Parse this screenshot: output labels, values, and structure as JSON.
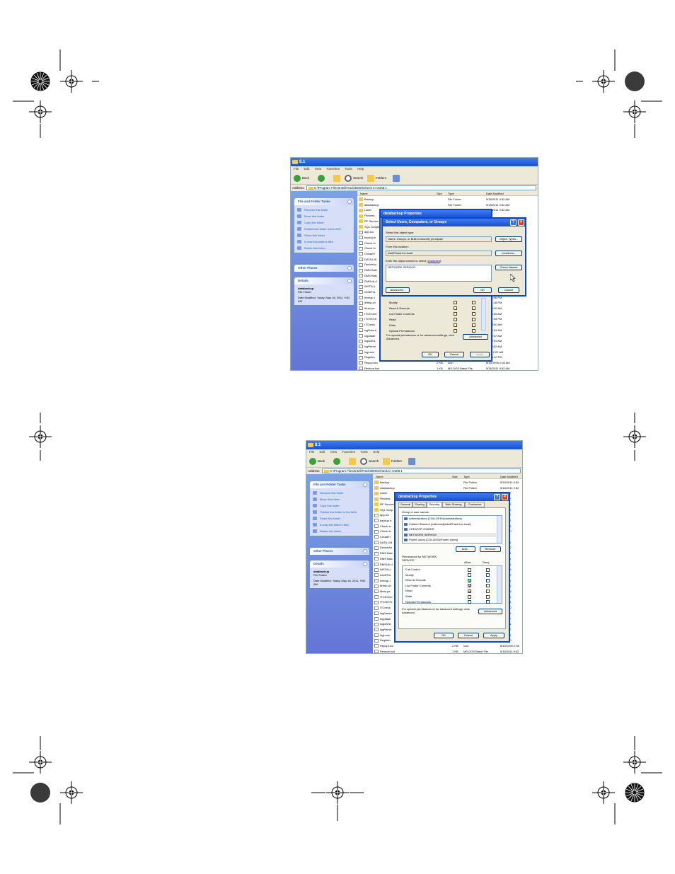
{
  "screenshot1": {
    "window_title": "8.1",
    "menu": [
      "File",
      "Edit",
      "View",
      "Favorites",
      "Tools",
      "Help"
    ],
    "toolbar": {
      "back": "Back",
      "search": "Search",
      "folders": "Folders"
    },
    "address_label": "Address",
    "address_value": "C:\\Program Files\\IntelliTrack\\DMS\\Check In Out\\8.1",
    "columns": {
      "name": "Name",
      "size": "Size",
      "type": "Type",
      "date": "Date Modified"
    },
    "files": [
      {
        "name": "Backup",
        "size": "",
        "type": "File Folder",
        "date": "5/18/2011 9:52 AM"
      },
      {
        "name": "databackup",
        "size": "",
        "type": "File Folder",
        "date": "5/18/2011 9:52 AM"
      },
      {
        "name": "Label",
        "size": "",
        "type": "",
        "date": "5/18/2011 9:52 AM"
      },
      {
        "name": "Pictures",
        "size": "",
        "type": "",
        "date": ""
      },
      {
        "name": "RF Service",
        "size": "",
        "type": "",
        "date": ""
      },
      {
        "name": "SQL Scripts",
        "size": "",
        "type": "",
        "date": ""
      },
      {
        "name": "app.ico",
        "size": "",
        "type": "",
        "date": ""
      },
      {
        "name": "backup.b",
        "size": "",
        "type": "",
        "date": ""
      },
      {
        "name": "Check In",
        "size": "",
        "type": "",
        "date": ""
      },
      {
        "name": "Check In",
        "size": "",
        "type": "",
        "date": ""
      },
      {
        "name": "CreateIT",
        "size": "",
        "type": "",
        "date": ""
      },
      {
        "name": "DATA.LIB",
        "size": "",
        "type": "",
        "date": ""
      },
      {
        "name": "DeviceAo",
        "size": "",
        "type": "",
        "date": ""
      },
      {
        "name": "DMS Batc",
        "size": "",
        "type": "",
        "date": ""
      },
      {
        "name": "DMS Batc",
        "size": "",
        "type": "",
        "date": ""
      },
      {
        "name": "DMSLib.d",
        "size": "",
        "type": "",
        "date": ""
      },
      {
        "name": "INSTALL",
        "size": "",
        "type": "",
        "date": ""
      },
      {
        "name": "IntelliTra",
        "size": "",
        "type": "",
        "date": "011 4:06 PM"
      },
      {
        "name": "Interop.I",
        "size": "",
        "type": "",
        "date": "011 4:06 PM"
      },
      {
        "name": "ItHelp.ch",
        "size": "",
        "type": "",
        "date": "011 1:16 PM"
      },
      {
        "name": "ItInfo.pa",
        "size": "",
        "type": "",
        "date": "999 3:05 AM"
      },
      {
        "name": "ITCECher",
        "size": "",
        "type": "",
        "date": "011 8:50 AM"
      },
      {
        "name": "ITCHECK",
        "size": "",
        "type": "",
        "date": "011 1:54 PM"
      },
      {
        "name": "ITCheck.",
        "size": "",
        "type": "",
        "date": "010 8:50 AM"
      },
      {
        "name": "logData.e",
        "size": "",
        "type": "",
        "date": "011 9:51 AM"
      },
      {
        "name": "logdatab",
        "size": "",
        "type": "",
        "date": "011 9:47 AM"
      },
      {
        "name": "logDATA",
        "size": "",
        "type": "",
        "date": "011 9:51 AM"
      },
      {
        "name": "logPermi",
        "size": "",
        "type": "",
        "date": "011 9:52 AM"
      },
      {
        "name": "logLexe",
        "size": "",
        "type": "",
        "date": "011 12:22 AM"
      },
      {
        "name": "Register",
        "size": "",
        "type": "",
        "date": "008 5:10 PM"
      },
      {
        "name": "Repcpt.ico",
        "size": "2 KB",
        "type": "Icon",
        "date": "8/15/1995 2:08 AM"
      },
      {
        "name": "Restore.bat",
        "size": "1 KB",
        "type": "MS-DOS Batch File",
        "date": "5/18/2011 9:52 AM"
      }
    ],
    "side": {
      "tasks_title": "File and Folder Tasks",
      "tasks": [
        "Rename this folder",
        "Move this folder",
        "Copy this folder",
        "Publish this folder to the Web",
        "Share this folder",
        "E-mail this folder's files",
        "Delete this folder"
      ],
      "other_places": "Other Places",
      "details": "Details",
      "detail_name": "databackup",
      "detail_type": "File Folder",
      "detail_date": "Date Modified: Today, May 18, 2011, 9:52 AM"
    },
    "props": {
      "title": "databackup Properties",
      "perms": [
        "Modify",
        "Read & Execute",
        "List Folder Contents",
        "Read",
        "Write",
        "Special Permissions"
      ],
      "special_note": "For special permissions or for advanced settings, click Advanced.",
      "advanced": "Advanced",
      "ok": "OK",
      "cancel": "Cancel",
      "apply": "Apply"
    },
    "select": {
      "title": "Select Users, Computers, or Groups",
      "obj_type_label": "Select this object type:",
      "obj_type_value": "Users, Groups, or Built-in security principals",
      "obj_types_btn": "Object Types...",
      "loc_label": "From this location:",
      "loc_value": "IntelliTrack.Inc.local",
      "loc_btn": "Locations...",
      "names_label_pre": "Enter the object names to select (",
      "names_label_link": "examples",
      "names_label_post": "):",
      "names_value": "NETWORK SERVICE",
      "check_btn": "Check Names",
      "advanced_btn": "Advanced...",
      "ok": "OK",
      "cancel": "Cancel"
    }
  },
  "screenshot2": {
    "window_title": "8.1",
    "menu": [
      "File",
      "Edit",
      "View",
      "Favorites",
      "Tools",
      "Help"
    ],
    "toolbar": {
      "back": "Back",
      "search": "Search",
      "folders": "Folders"
    },
    "address_label": "Address",
    "address_value": "C:\\Program Files\\IntelliTrack\\DMS\\Check In Out\\8.1",
    "columns": {
      "name": "Name",
      "size": "Size",
      "type": "Type",
      "date": "Date Modified"
    },
    "files": [
      {
        "name": "Backup",
        "size": "",
        "type": "File Folder",
        "date": "5/18/2011 9:52"
      },
      {
        "name": "databackup",
        "size": "",
        "type": "File Folder",
        "date": "5/18/2011 9:52"
      },
      {
        "name": "Label",
        "size": "",
        "type": "",
        "date": "011 9:52"
      },
      {
        "name": "Pictures",
        "size": "",
        "type": "",
        "date": "011 9:52"
      },
      {
        "name": "RF Service",
        "size": "",
        "type": "",
        "date": "011 9:52"
      },
      {
        "name": "SQL Scrip",
        "size": "",
        "type": "",
        "date": "011 9:52"
      },
      {
        "name": "app.ico",
        "size": "",
        "type": "",
        "date": "011 9:47"
      },
      {
        "name": "backup.b",
        "size": "",
        "type": "",
        "date": "011 9:52"
      },
      {
        "name": "Check In",
        "size": "",
        "type": "",
        "date": "003 1:41"
      },
      {
        "name": "Check In",
        "size": "",
        "type": "",
        "date": "010 8:50"
      },
      {
        "name": "CreateIT",
        "size": "",
        "type": "",
        "date": "008 3:1"
      },
      {
        "name": "DATA.LIB",
        "size": "",
        "type": "",
        "date": "011 1:15"
      },
      {
        "name": "DeviceAo",
        "size": "",
        "type": "",
        "date": "010 10:2"
      },
      {
        "name": "DMS Batc",
        "size": "",
        "type": "",
        "date": "011 4:06"
      },
      {
        "name": "DMS Batc",
        "size": "",
        "type": "",
        "date": "011 4:06"
      },
      {
        "name": "DMSLib.d",
        "size": "",
        "type": "",
        "date": "011 4:06"
      },
      {
        "name": "INSTALL",
        "size": "",
        "type": "",
        "date": "010 9:24"
      },
      {
        "name": "IntelliTra",
        "size": "",
        "type": "",
        "date": "010 3:57"
      },
      {
        "name": "Interop.I",
        "size": "",
        "type": "",
        "date": "011 4:06"
      },
      {
        "name": "ItHelp.ch",
        "size": "",
        "type": "",
        "date": "011 1:16"
      },
      {
        "name": "ItInfo.pa",
        "size": "",
        "type": "",
        "date": "999 3:05"
      },
      {
        "name": "ITCECher",
        "size": "",
        "type": "",
        "date": "011 8:50"
      },
      {
        "name": "ITCHECK",
        "size": "",
        "type": "",
        "date": "011 1:54"
      },
      {
        "name": "ITCheck.",
        "size": "",
        "type": "",
        "date": "010 8:50"
      },
      {
        "name": "logData.e",
        "size": "",
        "type": "",
        "date": "011 9:51"
      },
      {
        "name": "logdatab",
        "size": "",
        "type": "",
        "date": "011 9:47"
      },
      {
        "name": "logDATA",
        "size": "",
        "type": "",
        "date": "011 9:51"
      },
      {
        "name": "logPermi",
        "size": "",
        "type": "",
        "date": "011 9:52"
      },
      {
        "name": "logLexe",
        "size": "",
        "type": "",
        "date": "011 12:2"
      },
      {
        "name": "Register",
        "size": "",
        "type": "",
        "date": "008 5:10"
      },
      {
        "name": "Repcpt.ico",
        "size": "2 KB",
        "type": "Icon",
        "date": "8/15/1995 2:08"
      },
      {
        "name": "Restore.bat",
        "size": "1 KB",
        "type": "MS-DOS Batch File",
        "date": "5/18/2011 9:52"
      }
    ],
    "side": {
      "tasks_title": "File and Folder Tasks",
      "tasks": [
        "Rename this folder",
        "Move this folder",
        "Copy this folder",
        "Publish this folder to the Web",
        "Share this folder",
        "E-mail this folder's files",
        "Delete this folder"
      ],
      "other_places": "Other Places",
      "details": "Details",
      "detail_name": "databackup",
      "detail_type": "File Folder",
      "detail_date": "Date Modified: Today, May 18, 2011, 9:52 AM"
    },
    "props": {
      "title": "databackup Properties",
      "tabs": [
        "General",
        "Sharing",
        "Security",
        "Web Sharing",
        "Customize"
      ],
      "active_tab": 2,
      "group_label": "Group or user names:",
      "users": [
        "Administrators (COLLEEN\\Administrators)",
        "Colleen Starmon (colleens@IntelliTrack.Inc.local)",
        "CREATOR OWNER",
        "NETWORK SERVICE",
        "Power Users (COLLEEN\\Power Users)"
      ],
      "selected_user": 3,
      "add": "Add...",
      "remove": "Remove",
      "perm_for": "Permissions for NETWORK SERVICE",
      "allow": "Allow",
      "deny": "Deny",
      "perms": [
        {
          "name": "Full Control",
          "allow": false,
          "deny": false
        },
        {
          "name": "Modify",
          "allow": false,
          "deny": false
        },
        {
          "name": "Read & Execute",
          "allow": true,
          "deny": false
        },
        {
          "name": "List Folder Contents",
          "allow": true,
          "deny": false
        },
        {
          "name": "Read",
          "allow": true,
          "deny": false
        },
        {
          "name": "Write",
          "allow": false,
          "deny": false
        },
        {
          "name": "Special Permissions",
          "allow": false,
          "deny": false
        }
      ],
      "special_note": "For special permissions or for advanced settings, click Advanced.",
      "advanced": "Advanced",
      "ok": "OK",
      "cancel": "Cancel",
      "apply": "Apply"
    }
  }
}
